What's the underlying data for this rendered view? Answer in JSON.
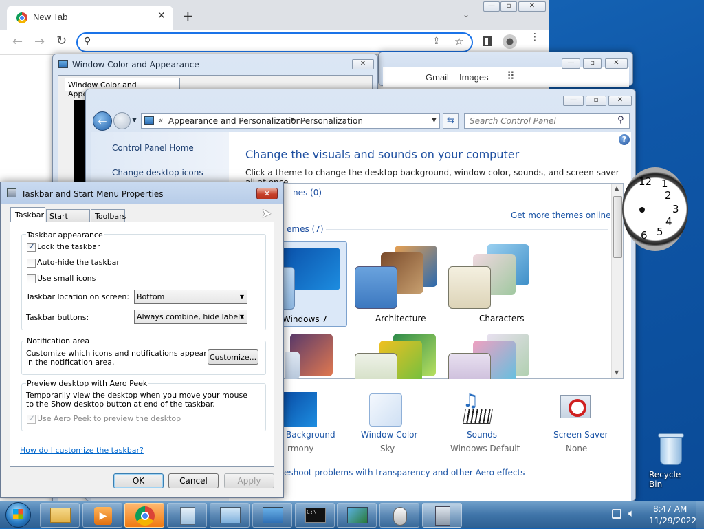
{
  "browser": {
    "tab_title": "New Tab",
    "links": {
      "gmail": "Gmail",
      "images": "Images"
    }
  },
  "wca_window": {
    "title": "Window Color and Appearance",
    "tab": "Window Color and Appearance"
  },
  "control_panel": {
    "breadcrumb": [
      "Appearance and Personalization",
      "Personalization"
    ],
    "search_placeholder": "Search Control Panel",
    "nav": [
      "Control Panel Home",
      "Change desktop icons"
    ],
    "heading": "Change the visuals and sounds on your computer",
    "subheading": "Click a theme to change the desktop background, window color, sounds, and screen saver all at once.",
    "my_themes": "nes (0)",
    "get_more": "Get more themes online",
    "aero_themes": "emes (7)",
    "themes": [
      "Windows 7",
      "Architecture",
      "Characters"
    ],
    "bottom_items": [
      {
        "label": "Background",
        "sub": "rmony"
      },
      {
        "label": "Window Color",
        "sub": "Sky"
      },
      {
        "label": "Sounds",
        "sub": "Windows Default"
      },
      {
        "label": "Screen Saver",
        "sub": "None"
      }
    ],
    "trouble": "eshoot problems with transparency and other Aero effects"
  },
  "dialog": {
    "title": "Taskbar and Start Menu Properties",
    "tabs": [
      "Taskbar",
      "Start Menu",
      "Toolbars"
    ],
    "appearance": {
      "header": "Taskbar appearance",
      "lock": "Lock the taskbar",
      "autohide": "Auto-hide the taskbar",
      "small": "Use small icons",
      "location_label": "Taskbar location on screen:",
      "location_value": "Bottom",
      "buttons_label": "Taskbar buttons:",
      "buttons_value": "Always combine, hide labels"
    },
    "lock_checked": true,
    "autohide_checked": false,
    "small_checked": false,
    "aero_checked": true,
    "notification": {
      "header": "Notification area",
      "text": "Customize which icons and notifications appear in the notification area.",
      "button": "Customize..."
    },
    "peek": {
      "header": "Preview desktop with Aero Peek",
      "text": "Temporarily view the desktop when you move your mouse to the Show desktop button at end of the taskbar.",
      "checkbox": "Use Aero Peek to preview the desktop"
    },
    "help_link": "How do I customize the taskbar?",
    "ok": "OK",
    "cancel": "Cancel",
    "apply": "Apply"
  },
  "desktop": {
    "recycle_bin": "Recycle Bin",
    "clock_numbers": [
      "12",
      "1",
      "2",
      "3",
      "4",
      "5",
      "6"
    ]
  },
  "taskbar": {
    "time": "8:47 AM",
    "date": "11/29/2022"
  },
  "colors": {
    "link": "#1c55a6",
    "heading": "#1e4fa0",
    "desktop": "#0f57a8"
  }
}
